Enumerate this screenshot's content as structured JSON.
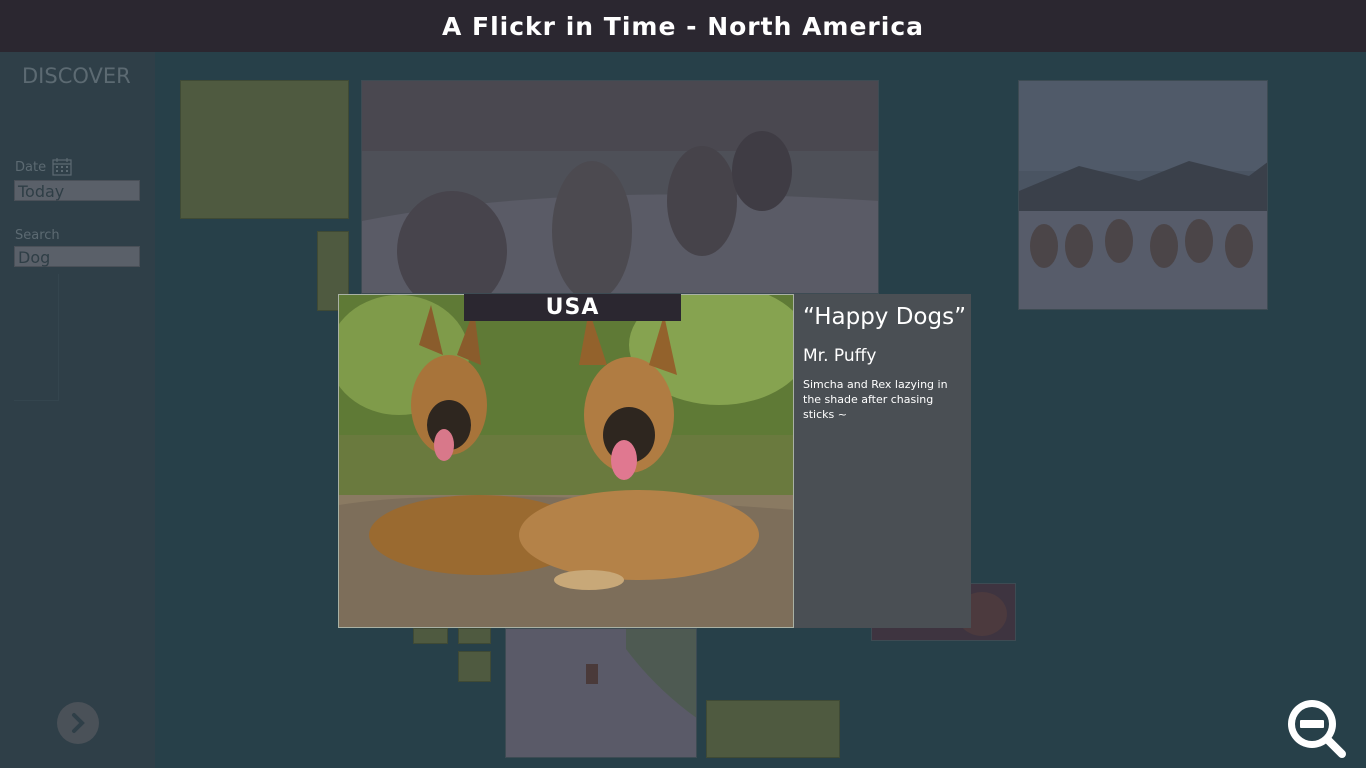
{
  "header": {
    "title": "A Flickr in Time - North America"
  },
  "sidebar": {
    "title": "DISCOVER",
    "date_label": "Date",
    "date_value": "Today",
    "search_label": "Search",
    "search_value": "Dog"
  },
  "icons": {
    "calendar": "calendar-icon",
    "next": "chevron-right-icon",
    "zoom_out": "zoom-out-icon"
  },
  "detail": {
    "country": "USA",
    "caption": "“Happy Dogs”",
    "author": "Mr. Puffy",
    "description": "Simcha and Rex lazying in the shade after chasing sticks ~"
  },
  "colors": {
    "header_bg": "#2b2730",
    "map_bg": "#274049",
    "sidebar_bg": "#2f3f48",
    "olive_tile": "#4f5a40",
    "info_panel": "#4a4f54"
  }
}
